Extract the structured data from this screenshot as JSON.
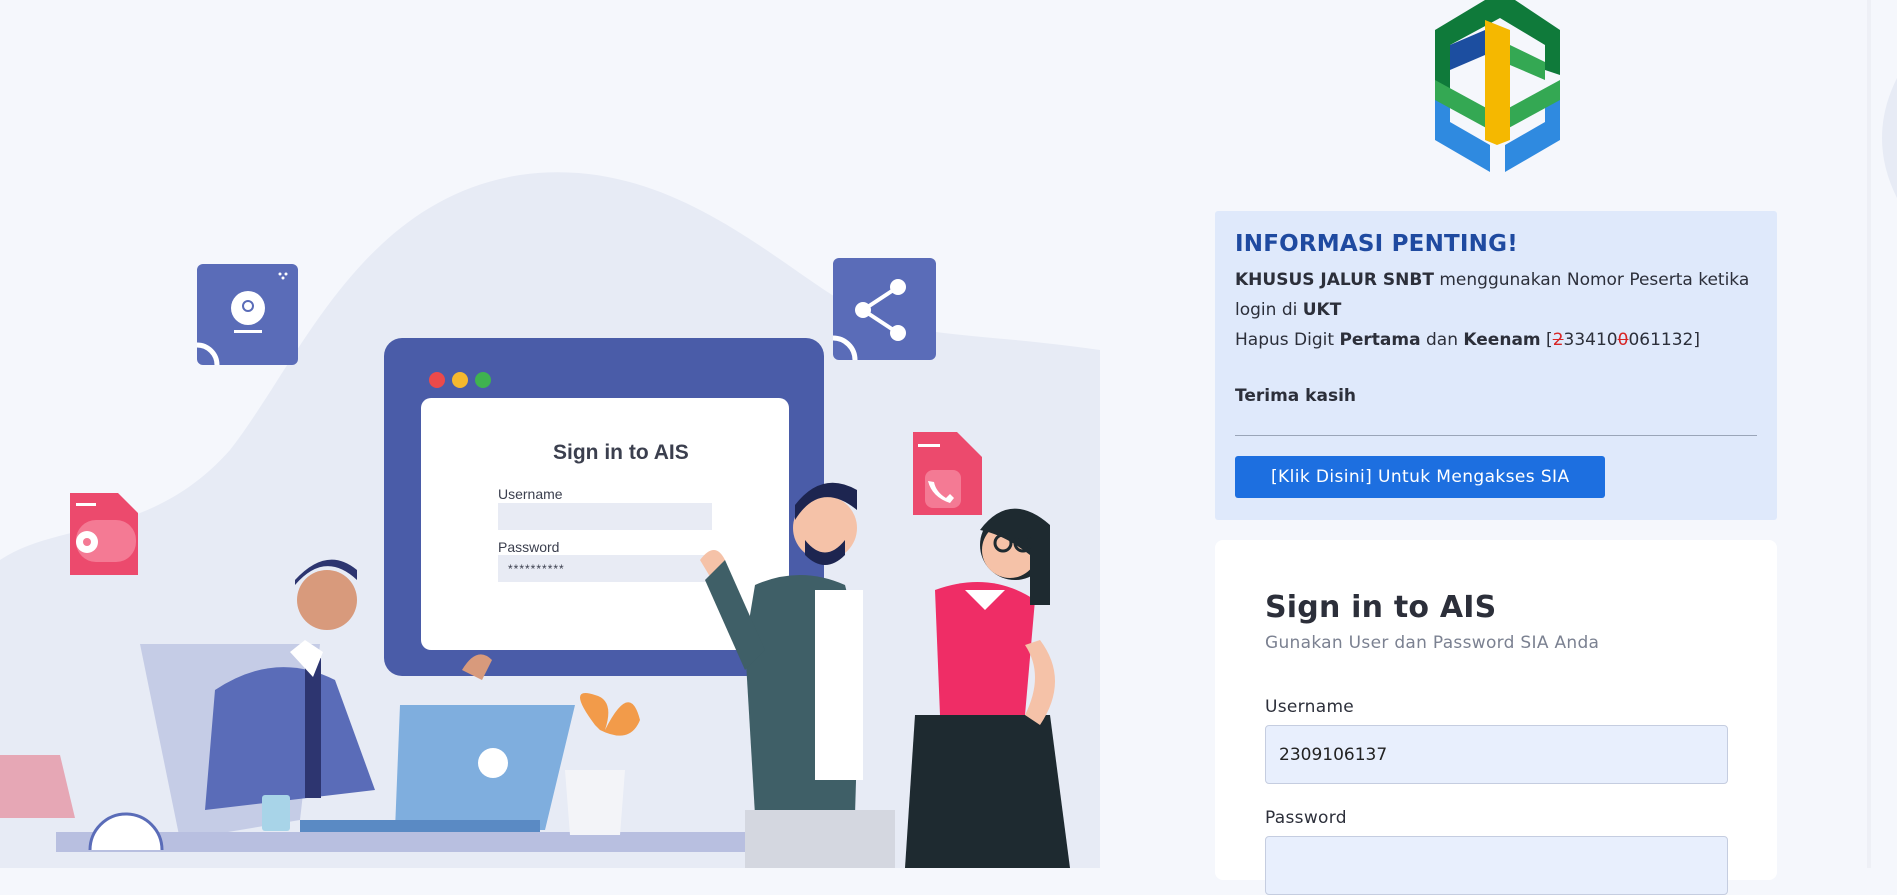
{
  "illustration": {
    "mock_title": "Sign in to AIS",
    "mock_username_label": "Username",
    "mock_password_label": "Password",
    "mock_password_dots": "**********"
  },
  "info": {
    "heading": "INFORMASI PENTING!",
    "line1_bold": "KHUSUS JALUR SNBT",
    "line1_text": " menggunakan Nomor Peserta ketika login di ",
    "line1_bold2": "UKT",
    "line2_text": "Hapus Digit ",
    "line2_bold1": "Pertama",
    "line2_mid": " dan ",
    "line2_bold2": "Keenam",
    "line2_open": " [",
    "example_d1": "2",
    "example_part1": "33410",
    "example_d6": "0",
    "example_part2": "061132",
    "line2_close": "]",
    "thanks": "Terima kasih",
    "button_label": "[Klik Disini] Untuk Mengakses SIA"
  },
  "signin": {
    "title": "Sign in to AIS",
    "subtitle": "Gunakan User dan Password SIA Anda",
    "username_label": "Username",
    "username_value": "2309106137",
    "password_label": "Password"
  },
  "colors": {
    "accent": "#1d6fe0",
    "info_bg": "#dfe9fb",
    "heading": "#1f4aa0",
    "strike": "#d82525"
  }
}
